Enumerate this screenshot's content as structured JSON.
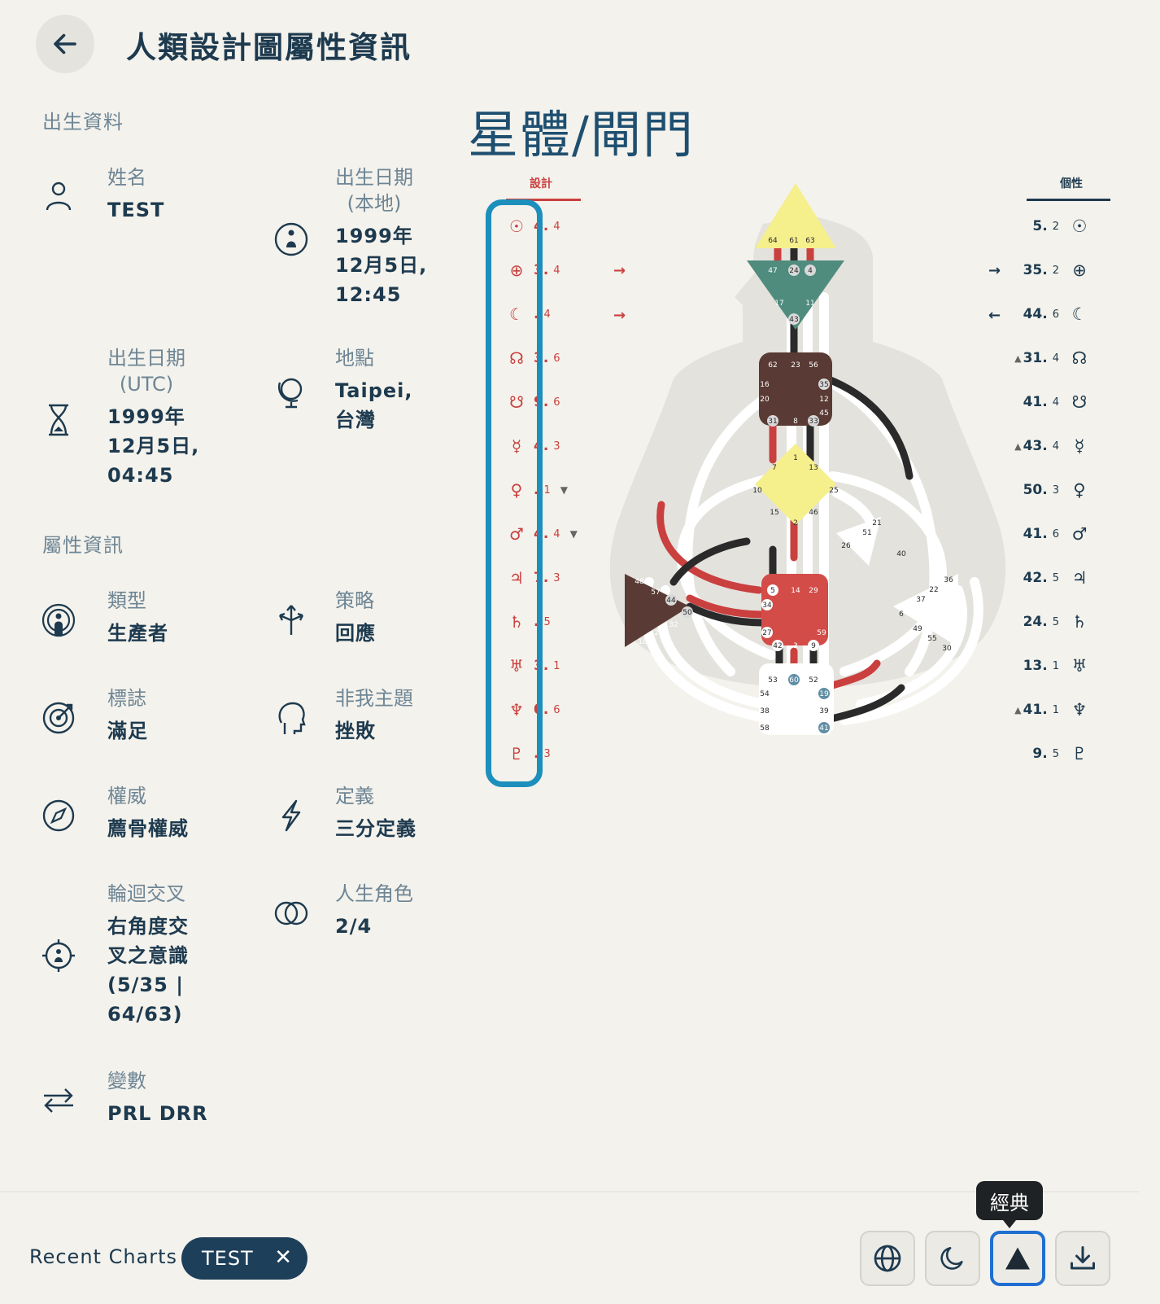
{
  "header": {
    "title": "人類設計圖屬性資訊"
  },
  "birth": {
    "section": "出生資料",
    "name_label": "姓名",
    "name_value": "TEST",
    "local_date_label_1": "出生日期",
    "local_date_label_2": "(本地)",
    "local_date_1": "1999年",
    "local_date_2": "12月5日,",
    "local_date_3": "12:45",
    "utc_label_1": "出生日期",
    "utc_label_2": "(UTC)",
    "utc_1": "1999年",
    "utc_2": "12月5日,",
    "utc_3": "04:45",
    "place_label": "地點",
    "place_1": "Taipei,",
    "place_2": "台灣"
  },
  "attrs": {
    "section": "屬性資訊",
    "type_label": "類型",
    "type_value": "生產者",
    "strategy_label": "策略",
    "strategy_value": "回應",
    "signature_label": "標誌",
    "signature_value": "滿足",
    "notself_label": "非我主題",
    "notself_value": "挫敗",
    "authority_label": "權威",
    "authority_value": "薦骨權威",
    "definition_label": "定義",
    "definition_value": "三分定義",
    "cross_label": "輪迴交叉",
    "cross_1": "右角度交",
    "cross_2": "叉之意識",
    "cross_3": "(5/35 |",
    "cross_4": "64/63)",
    "profile_label": "人生角色",
    "profile_value": "2/4",
    "variable_label": "變數",
    "variable_value": "PRL DRR"
  },
  "chart": {
    "title": "星體/閘門",
    "design_header": "設計",
    "personality_header": "個性",
    "design_rows": [
      {
        "glyph": "☉",
        "value": "4.",
        "line": "4",
        "mark": ""
      },
      {
        "glyph": "⊕",
        "value": "3.",
        "line": "4",
        "mark": ""
      },
      {
        "glyph": "☾",
        "value": ".",
        "line": "4",
        "mark": ""
      },
      {
        "glyph": "☊",
        "value": "3.",
        "line": "6",
        "mark": ""
      },
      {
        "glyph": "☋",
        "value": "9.",
        "line": "6",
        "mark": ""
      },
      {
        "glyph": "☿",
        "value": "4.",
        "line": "3",
        "mark": ""
      },
      {
        "glyph": "♀",
        "value": ".",
        "line": "1",
        "mark": "▼"
      },
      {
        "glyph": "♂",
        "value": "4.",
        "line": "4",
        "mark": "▼"
      },
      {
        "glyph": "♃",
        "value": "7.",
        "line": "3",
        "mark": ""
      },
      {
        "glyph": "♄",
        "value": ".",
        "line": "5",
        "mark": ""
      },
      {
        "glyph": "♅",
        "value": "3.",
        "line": "1",
        "mark": ""
      },
      {
        "glyph": "♆",
        "value": "0.",
        "line": "6",
        "mark": ""
      },
      {
        "glyph": "♇",
        "value": ".",
        "line": "3",
        "mark": ""
      }
    ],
    "personality_rows": [
      {
        "mark": "",
        "value": "5.",
        "line": "2",
        "glyph": "☉"
      },
      {
        "mark": "",
        "value": "35.",
        "line": "2",
        "glyph": "⊕"
      },
      {
        "mark": "",
        "value": "44.",
        "line": "6",
        "glyph": "☾"
      },
      {
        "mark": "▲",
        "value": "31.",
        "line": "4",
        "glyph": "☊"
      },
      {
        "mark": "",
        "value": "41.",
        "line": "4",
        "glyph": "☋"
      },
      {
        "mark": "▲",
        "value": "43.",
        "line": "4",
        "glyph": "☿"
      },
      {
        "mark": "",
        "value": "50.",
        "line": "3",
        "glyph": "♀"
      },
      {
        "mark": "",
        "value": "41.",
        "line": "6",
        "glyph": "♂"
      },
      {
        "mark": "",
        "value": "42.",
        "line": "5",
        "glyph": "♃"
      },
      {
        "mark": "",
        "value": "24.",
        "line": "5",
        "glyph": "♄"
      },
      {
        "mark": "",
        "value": "13.",
        "line": "1",
        "glyph": "♅"
      },
      {
        "mark": "▲",
        "value": "41.",
        "line": "1",
        "glyph": "♆"
      },
      {
        "mark": "",
        "value": "9.",
        "line": "5",
        "glyph": "♇"
      }
    ],
    "colors": {
      "design": "#c9403f",
      "personality": "#1d3a4f",
      "highlight": "#1c8fbc"
    }
  },
  "footer": {
    "recent_label": "Recent Charts",
    "chip_label": "TEST",
    "chip_close": "✕",
    "tooltip": "經典",
    "buttons": [
      "globe-icon",
      "moon-icon",
      "triangle-icon",
      "download-icon"
    ]
  }
}
